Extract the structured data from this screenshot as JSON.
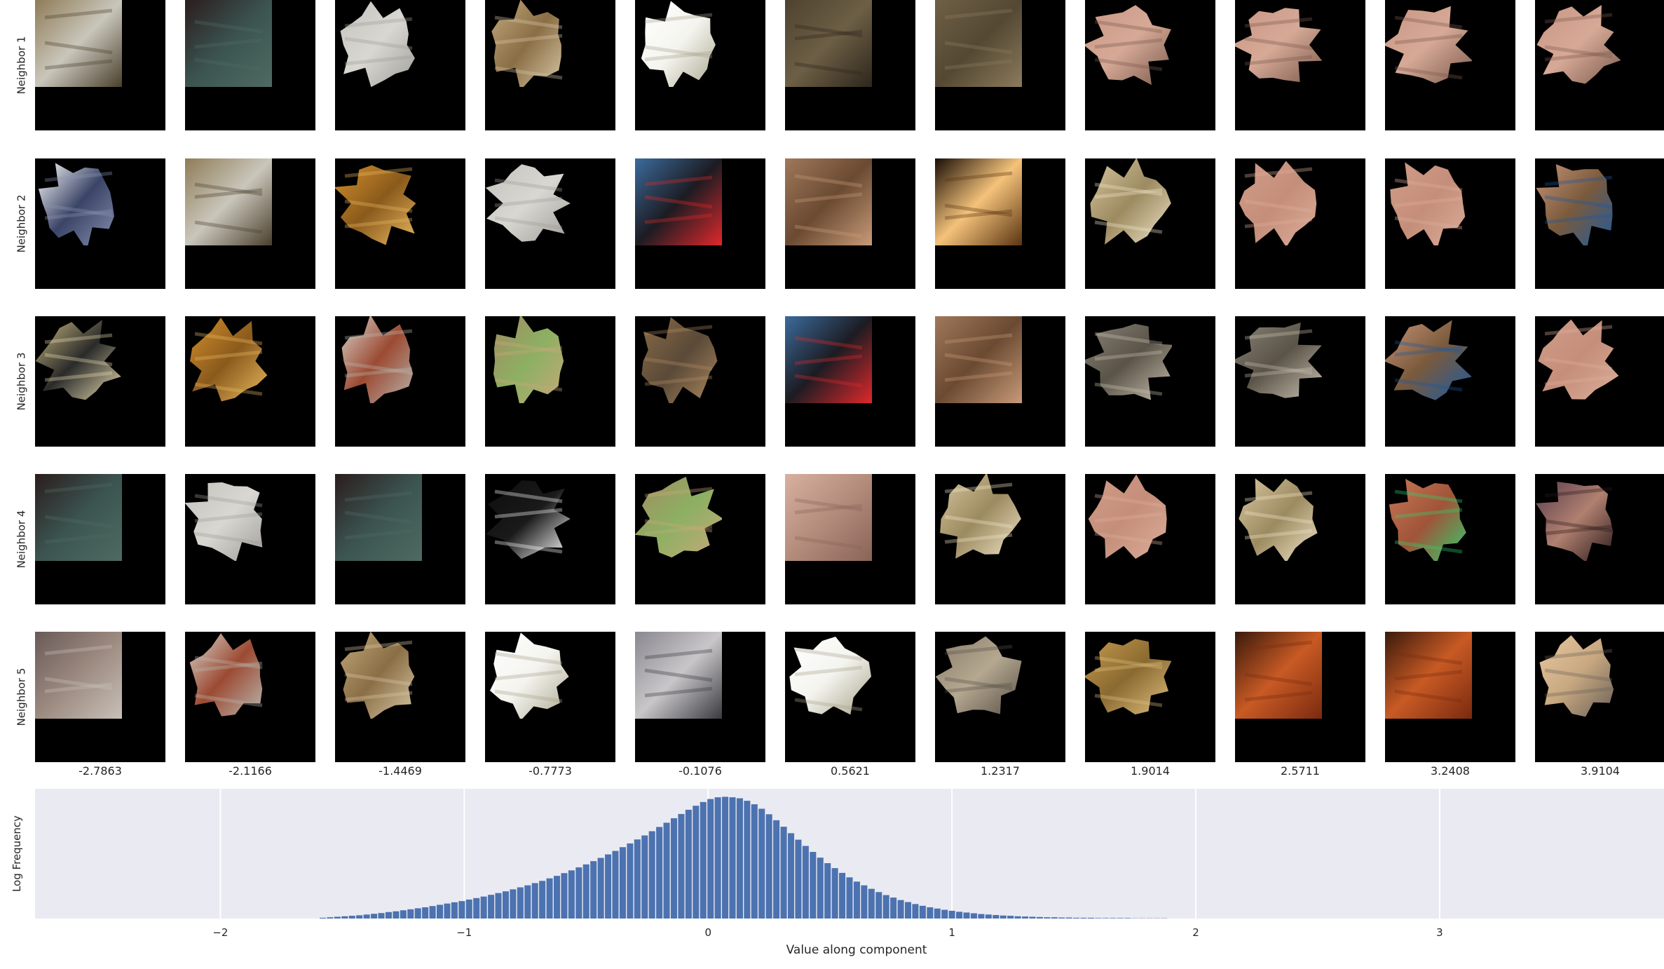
{
  "row_labels": [
    "Neighbor 1",
    "Neighbor 2",
    "Neighbor 3",
    "Neighbor 4",
    "Neighbor 5"
  ],
  "column_values": [
    "-2.7863",
    "-2.1166",
    "-1.4469",
    "-0.7773",
    "-0.1076",
    "0.5621",
    "1.2317",
    "1.9014",
    "2.5711",
    "3.2408",
    "3.9104"
  ],
  "patches": [
    [
      {
        "name": "machinery",
        "colors": [
          "#8f7c57",
          "#c9c6bb",
          "#4a3f2c"
        ],
        "mask": "full"
      },
      {
        "name": "dark-door",
        "colors": [
          "#2b1d1d",
          "#3b5450",
          "#4f6a62"
        ],
        "mask": "full"
      },
      {
        "name": "white-fence",
        "colors": [
          "#c4c2bd",
          "#d9d7d2",
          "#a09e99"
        ],
        "mask": "blob"
      },
      {
        "name": "wood-planks",
        "colors": [
          "#c2a97c",
          "#8a6e45",
          "#d9c9a8"
        ],
        "mask": "blob"
      },
      {
        "name": "white-bottle",
        "colors": [
          "#ffffff",
          "#f4f4ef",
          "#a9a48b"
        ],
        "mask": "blob"
      },
      {
        "name": "animal-fur-dark",
        "colors": [
          "#4e4230",
          "#6d5f45",
          "#2d261c"
        ],
        "mask": "full"
      },
      {
        "name": "animal-fur-brown",
        "colors": [
          "#6f6046",
          "#544833",
          "#8c7b5b"
        ],
        "mask": "full"
      },
      {
        "name": "face-skin",
        "colors": [
          "#c99684",
          "#d6a996",
          "#7a5a4d"
        ],
        "mask": "blob"
      },
      {
        "name": "face-skin",
        "colors": [
          "#c99684",
          "#d6a996",
          "#7a5a4d"
        ],
        "mask": "blob"
      },
      {
        "name": "face-skin",
        "colors": [
          "#c99684",
          "#d6a996",
          "#7a5a4d"
        ],
        "mask": "blob"
      },
      {
        "name": "face-skin",
        "colors": [
          "#c99684",
          "#d6a996",
          "#7a5a4d"
        ],
        "mask": "blob"
      }
    ],
    [
      {
        "name": "solar-panel",
        "colors": [
          "#ffffff",
          "#3a4466",
          "#8a93b3"
        ],
        "mask": "blob"
      },
      {
        "name": "machinery",
        "colors": [
          "#8f7c57",
          "#c9c6bb",
          "#4a3f2c"
        ],
        "mask": "full"
      },
      {
        "name": "autumn-leaves",
        "colors": [
          "#d4902c",
          "#8a5a1c",
          "#e8b860"
        ],
        "mask": "blob"
      },
      {
        "name": "white-fence",
        "colors": [
          "#c4c2bd",
          "#d9d7d2",
          "#a09e99"
        ],
        "mask": "blob"
      },
      {
        "name": "black-swan",
        "colors": [
          "#3c6b9c",
          "#1c1c22",
          "#e0282c"
        ],
        "mask": "full"
      },
      {
        "name": "dog-running",
        "colors": [
          "#a0785a",
          "#6a4a32",
          "#c89a78"
        ],
        "mask": "full"
      },
      {
        "name": "candle-light",
        "colors": [
          "#1a0e06",
          "#f4c27a",
          "#5a3412"
        ],
        "mask": "full"
      },
      {
        "name": "blond-hair",
        "colors": [
          "#d8c8a0",
          "#9c8a60",
          "#f0e6c8"
        ],
        "mask": "blob"
      },
      {
        "name": "skin-patch",
        "colors": [
          "#d09c88",
          "#c48e7a",
          "#dcae9a"
        ],
        "mask": "blob"
      },
      {
        "name": "skin-patch",
        "colors": [
          "#d09c88",
          "#c48e7a",
          "#dcae9a"
        ],
        "mask": "blob"
      },
      {
        "name": "woman-profile",
        "colors": [
          "#c89478",
          "#7a5a3c",
          "#1c5aa0"
        ],
        "mask": "blob"
      }
    ],
    [
      {
        "name": "scissors",
        "colors": [
          "#c9b880",
          "#2a2a2a",
          "#e8dcb0"
        ],
        "mask": "blob"
      },
      {
        "name": "autumn-leaves",
        "colors": [
          "#d4902c",
          "#8a5a1c",
          "#e8b860"
        ],
        "mask": "blob"
      },
      {
        "name": "fence-ground",
        "colors": [
          "#d8d6d0",
          "#9c4a32",
          "#b8b6b0"
        ],
        "mask": "blob"
      },
      {
        "name": "fur-grass",
        "colors": [
          "#a48a62",
          "#8cb062",
          "#c8a87a"
        ],
        "mask": "blob"
      },
      {
        "name": "monkey-fur",
        "colors": [
          "#8a6a48",
          "#5a4a38",
          "#b08a60"
        ],
        "mask": "blob"
      },
      {
        "name": "black-swan",
        "colors": [
          "#3c6b9c",
          "#1c1c22",
          "#e0282c"
        ],
        "mask": "full"
      },
      {
        "name": "dog-running",
        "colors": [
          "#a0785a",
          "#6a4a32",
          "#c89a78"
        ],
        "mask": "full"
      },
      {
        "name": "grey-cat",
        "colors": [
          "#8a8478",
          "#5a5448",
          "#c8c0b0"
        ],
        "mask": "blob"
      },
      {
        "name": "grey-cat",
        "colors": [
          "#8a8478",
          "#5a5448",
          "#c8c0b0"
        ],
        "mask": "blob"
      },
      {
        "name": "woman-profile",
        "colors": [
          "#c89478",
          "#7a5a3c",
          "#1c5aa0"
        ],
        "mask": "blob"
      },
      {
        "name": "skin-patch",
        "colors": [
          "#d09c88",
          "#c48e7a",
          "#dcae9a"
        ],
        "mask": "blob"
      }
    ],
    [
      {
        "name": "dark-door",
        "colors": [
          "#2b1d1d",
          "#3b5450",
          "#4f6a62"
        ],
        "mask": "full"
      },
      {
        "name": "white-fence",
        "colors": [
          "#c4c2bd",
          "#d9d7d2",
          "#a09e99"
        ],
        "mask": "blob"
      },
      {
        "name": "dark-door",
        "colors": [
          "#2b1d1d",
          "#3b5450",
          "#4f6a62"
        ],
        "mask": "full"
      },
      {
        "name": "dark-scene",
        "colors": [
          "#0c0c0c",
          "#1a1a1a",
          "#ffffff"
        ],
        "mask": "blob"
      },
      {
        "name": "fur-grass",
        "colors": [
          "#a48a62",
          "#8cb062",
          "#c8a87a"
        ],
        "mask": "blob"
      },
      {
        "name": "pig-snout",
        "colors": [
          "#d8b0a0",
          "#b48c7c",
          "#8a6458"
        ],
        "mask": "full"
      },
      {
        "name": "blond-hair",
        "colors": [
          "#d8c8a0",
          "#9c8a60",
          "#f0e6c8"
        ],
        "mask": "blob"
      },
      {
        "name": "skin-patch",
        "colors": [
          "#d09c88",
          "#c48e7a",
          "#dcae9a"
        ],
        "mask": "blob"
      },
      {
        "name": "blond-hair",
        "colors": [
          "#d8c8a0",
          "#9c8a60",
          "#f0e6c8"
        ],
        "mask": "blob"
      },
      {
        "name": "face-closeup",
        "colors": [
          "#c87858",
          "#a05438",
          "#30d070"
        ],
        "mask": "blob"
      },
      {
        "name": "man-face",
        "colors": [
          "#5a3c4c",
          "#b08070",
          "#2a1a1a"
        ],
        "mask": "blob"
      }
    ],
    [
      {
        "name": "wood-boards",
        "colors": [
          "#6a5a58",
          "#9c8a80",
          "#c8c0b8"
        ],
        "mask": "full"
      },
      {
        "name": "fence-ground",
        "colors": [
          "#d8d6d0",
          "#9c4a32",
          "#b8b6b0"
        ],
        "mask": "blob"
      },
      {
        "name": "wood-planks",
        "colors": [
          "#c2a97c",
          "#8a6e45",
          "#d9c9a8"
        ],
        "mask": "blob"
      },
      {
        "name": "white-bottle",
        "colors": [
          "#ffffff",
          "#f4f4ef",
          "#a9a48b"
        ],
        "mask": "blob"
      },
      {
        "name": "bottle-label",
        "colors": [
          "#8a8890",
          "#c8c6c8",
          "#3a3a40"
        ],
        "mask": "full"
      },
      {
        "name": "white-bottle",
        "colors": [
          "#ffffff",
          "#f4f4ef",
          "#a9a48b"
        ],
        "mask": "blob"
      },
      {
        "name": "hedgehog",
        "colors": [
          "#8a7c6a",
          "#b4a890",
          "#5a5048"
        ],
        "mask": "blob"
      },
      {
        "name": "golden-fur",
        "colors": [
          "#c89a50",
          "#8a6a30",
          "#e0c080"
        ],
        "mask": "blob"
      },
      {
        "name": "fire-glow",
        "colors": [
          "#3a1a0c",
          "#c85a24",
          "#7a2a10"
        ],
        "mask": "full"
      },
      {
        "name": "fire-glow",
        "colors": [
          "#3a1a0c",
          "#c85a24",
          "#7a2a10"
        ],
        "mask": "full"
      },
      {
        "name": "pale-skin",
        "colors": [
          "#e8c8a0",
          "#c8a880",
          "#6a6058"
        ],
        "mask": "blob"
      }
    ]
  ],
  "chart_data": {
    "type": "bar",
    "xlabel": "Value along component",
    "ylabel": "Log Frequency",
    "xlim": [
      -2.76,
      3.92
    ],
    "ylim": [
      0,
      5.2
    ],
    "xticks": [
      -2,
      -1,
      0,
      1,
      2,
      3
    ],
    "xtick_labels": [
      "−2",
      "−1",
      "0",
      "1",
      "2",
      "3"
    ],
    "grid": true,
    "bar_color": "#4c72b0",
    "background": "#eaeaf2",
    "x": [
      -1.58,
      -1.55,
      -1.52,
      -1.49,
      -1.46,
      -1.43,
      -1.4,
      -1.37,
      -1.34,
      -1.31,
      -1.28,
      -1.25,
      -1.22,
      -1.19,
      -1.16,
      -1.13,
      -1.1,
      -1.07,
      -1.04,
      -1.01,
      -0.98,
      -0.95,
      -0.92,
      -0.89,
      -0.86,
      -0.83,
      -0.8,
      -0.77,
      -0.74,
      -0.71,
      -0.68,
      -0.65,
      -0.62,
      -0.59,
      -0.56,
      -0.53,
      -0.5,
      -0.47,
      -0.44,
      -0.41,
      -0.38,
      -0.35,
      -0.32,
      -0.29,
      -0.26,
      -0.23,
      -0.2,
      -0.17,
      -0.14,
      -0.11,
      -0.08,
      -0.05,
      -0.02,
      0.01,
      0.04,
      0.07,
      0.1,
      0.13,
      0.16,
      0.19,
      0.22,
      0.25,
      0.28,
      0.31,
      0.34,
      0.37,
      0.4,
      0.43,
      0.46,
      0.49,
      0.52,
      0.55,
      0.58,
      0.61,
      0.64,
      0.67,
      0.7,
      0.73,
      0.76,
      0.79,
      0.82,
      0.85,
      0.88,
      0.91,
      0.94,
      0.97,
      1.0,
      1.03,
      1.06,
      1.09,
      1.12,
      1.15,
      1.18,
      1.21,
      1.24,
      1.27,
      1.3,
      1.33,
      1.36,
      1.39,
      1.42,
      1.45,
      1.48,
      1.51,
      1.54,
      1.57,
      1.6,
      1.63,
      1.66,
      1.69,
      1.72,
      1.75,
      1.78,
      1.81,
      1.84,
      1.87
    ],
    "values": [
      0.03,
      0.05,
      0.07,
      0.09,
      0.11,
      0.13,
      0.16,
      0.19,
      0.22,
      0.26,
      0.29,
      0.33,
      0.37,
      0.41,
      0.45,
      0.5,
      0.55,
      0.6,
      0.65,
      0.7,
      0.76,
      0.82,
      0.88,
      0.95,
      1.02,
      1.09,
      1.17,
      1.25,
      1.33,
      1.42,
      1.51,
      1.61,
      1.71,
      1.82,
      1.93,
      2.05,
      2.17,
      2.3,
      2.43,
      2.57,
      2.71,
      2.86,
      3.01,
      3.17,
      3.33,
      3.5,
      3.67,
      3.84,
      4.02,
      4.19,
      4.36,
      4.52,
      4.67,
      4.79,
      4.86,
      4.88,
      4.86,
      4.82,
      4.72,
      4.58,
      4.4,
      4.18,
      3.94,
      3.68,
      3.42,
      3.16,
      2.91,
      2.67,
      2.44,
      2.22,
      2.02,
      1.83,
      1.65,
      1.48,
      1.33,
      1.19,
      1.06,
      0.94,
      0.84,
      0.74,
      0.66,
      0.58,
      0.51,
      0.45,
      0.4,
      0.35,
      0.31,
      0.27,
      0.24,
      0.21,
      0.18,
      0.16,
      0.14,
      0.12,
      0.11,
      0.09,
      0.08,
      0.07,
      0.06,
      0.05,
      0.05,
      0.04,
      0.04,
      0.03,
      0.03,
      0.03,
      0.02,
      0.02,
      0.02,
      0.02,
      0.02,
      0.01,
      0.01,
      0.01,
      0.01,
      0.01
    ]
  }
}
